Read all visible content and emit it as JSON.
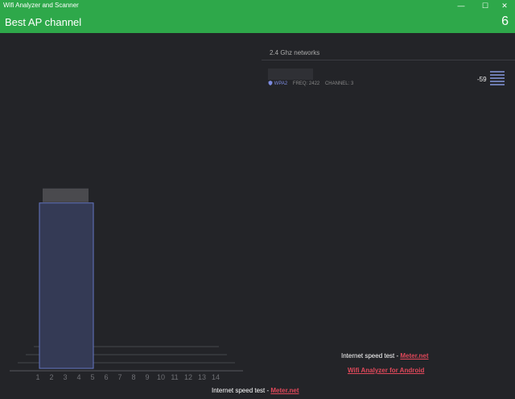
{
  "window": {
    "title": "Wifi Analyzer and Scanner",
    "minimize_glyph": "—",
    "maximize_glyph": "☐",
    "close_glyph": "✕"
  },
  "header": {
    "title": "Best AP channel",
    "best_channel": "6"
  },
  "chart_data": {
    "type": "bar",
    "categories": [
      "1",
      "2",
      "3",
      "4",
      "5",
      "6",
      "7",
      "8",
      "9",
      "10",
      "11",
      "12",
      "13",
      "14"
    ],
    "series": [
      {
        "channel_start": 2,
        "channel_end": 5,
        "value": 0.95
      }
    ],
    "ylim": [
      0,
      1
    ],
    "title": "",
    "xlabel": "",
    "ylabel": "",
    "colors": {
      "bar_fill": "#343a55",
      "bar_stroke": "#6577c4",
      "label_box": "#4a4a4e",
      "axis": "#6a6b70",
      "tick": "#6f7075"
    }
  },
  "networks": {
    "heading": "2.4 Ghz networks",
    "items": [
      {
        "security": "WPA2",
        "freq": "FREQ: 2422",
        "channel": "CHANNEL: 3",
        "rssi": "-59"
      }
    ]
  },
  "footer": {
    "speed_test_label": "Internet speed test - ",
    "speed_link": "Meter.net",
    "android_link": "Wifi Analyzer for Android",
    "speed_test_label_2": "Internet speed test - ",
    "speed_link_2": "Meter.net"
  }
}
